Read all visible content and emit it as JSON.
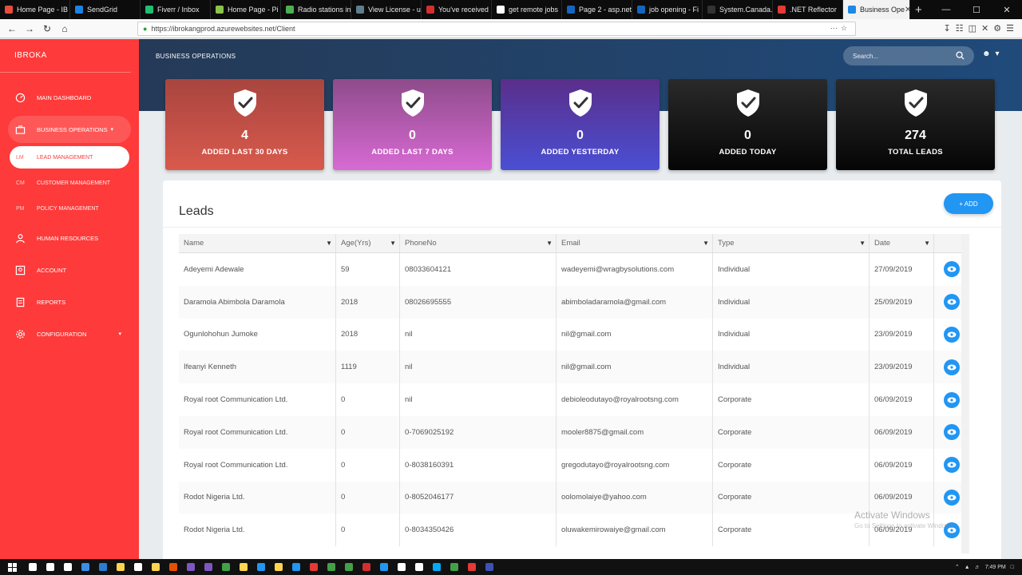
{
  "browser": {
    "tabs": [
      {
        "label": "Home Page - IB",
        "color": "#e84c3d"
      },
      {
        "label": "SendGrid",
        "color": "#1a82e2"
      },
      {
        "label": "Fiverr / Inbox",
        "color": "#1dbf73"
      },
      {
        "label": "Home Page - Pi",
        "color": "#8bc34a"
      },
      {
        "label": "Radio stations in",
        "color": "#4caf50"
      },
      {
        "label": "View License - u",
        "color": "#607d8b"
      },
      {
        "label": "You've received",
        "color": "#d32f2f"
      },
      {
        "label": "get remote jobs",
        "color": "#ffffff"
      },
      {
        "label": "Page 2 - asp.net",
        "color": "#1565c0"
      },
      {
        "label": "job opening - Fi",
        "color": "#1565c0"
      },
      {
        "label": "System.Canada.Te",
        "color": "#333333"
      },
      {
        "label": ".NET Reflector",
        "color": "#e53935"
      },
      {
        "label": "Business Ope",
        "color": "#1e88e5",
        "active": true
      }
    ],
    "url": "https://ibrokangprod.azurewebsites.net/Client"
  },
  "sidebar": {
    "brand": "IBROKA",
    "items": [
      {
        "label": "MAIN DASHBOARD",
        "icon": "dashboard-icon"
      },
      {
        "label": "BUSINESS OPERATIONS",
        "icon": "briefcase-icon",
        "open": true
      },
      {
        "label": "HUMAN RESOURCES",
        "icon": "person-icon"
      },
      {
        "label": "ACCOUNT",
        "icon": "account-icon"
      },
      {
        "label": "REPORTS",
        "icon": "reports-icon"
      },
      {
        "label": "CONFIGURATION",
        "icon": "gear-icon"
      }
    ],
    "subitems": [
      {
        "abbr": "LM",
        "label": "LEAD MANAGEMENT",
        "active": true
      },
      {
        "abbr": "CM",
        "label": "CUSTOMER MANAGEMENT"
      },
      {
        "abbr": "PM",
        "label": "POLICY MANAGEMENT"
      }
    ]
  },
  "header": {
    "title": "BUSINESS OPERATIONS",
    "search_placeholder": "Search..."
  },
  "cards": [
    {
      "value": "4",
      "label": "ADDED LAST 30 DAYS",
      "color_from": "#a8453f",
      "color_to": "#d95a4d"
    },
    {
      "value": "0",
      "label": "ADDED LAST 7 DAYS",
      "color_from": "#8e4b8a",
      "color_to": "#d86ad4"
    },
    {
      "value": "0",
      "label": "ADDED YESTERDAY",
      "color_from": "#5a2e8a",
      "color_to": "#4a4fd4"
    },
    {
      "value": "0",
      "label": "ADDED TODAY",
      "color_from": "#2a2a2a",
      "color_to": "#050505"
    },
    {
      "value": "274",
      "label": "TOTAL LEADS",
      "color_from": "#2a2a2a",
      "color_to": "#050505"
    }
  ],
  "leads": {
    "title": "Leads",
    "add_label": "+ ADD",
    "columns": [
      "Name",
      "Age(Yrs)",
      "PhoneNo",
      "Email",
      "Type",
      "Date"
    ],
    "rows": [
      [
        "Adeyemi Adewale",
        "59",
        "08033604121",
        "wadeyemi@wragbysolutions.com",
        "Individual",
        "27/09/2019"
      ],
      [
        "Daramola Abimbola Daramola",
        "2018",
        "08026695555",
        "abimboladaramola@gmail.com",
        "Individual",
        "25/09/2019"
      ],
      [
        "Ogunlohohun Jumoke",
        "2018",
        "nil",
        "nil@gmail.com",
        "Individual",
        "23/09/2019"
      ],
      [
        "Ifeanyi Kenneth",
        "1119",
        "nil",
        "nil@gmail.com",
        "Individual",
        "23/09/2019"
      ],
      [
        "Royal root Communication Ltd.",
        "0",
        "nil",
        "debioleodutayo@royalrootsng.com",
        "Corporate",
        "06/09/2019"
      ],
      [
        "Royal root Communication Ltd.",
        "0",
        "0-7069025192",
        "mooler8875@gmail.com",
        "Corporate",
        "06/09/2019"
      ],
      [
        "Royal root Communication Ltd.",
        "0",
        "0-8038160391",
        "gregodutayo@royalrootsng.com",
        "Corporate",
        "06/09/2019"
      ],
      [
        "Rodot Nigeria Ltd.",
        "0",
        "0-8052046177",
        "oolomolaiye@yahoo.com",
        "Corporate",
        "06/09/2019"
      ],
      [
        "Rodot Nigeria Ltd.",
        "0",
        "0-8034350426",
        "oluwakemirowaiye@gmail.com",
        "Corporate",
        "06/09/2019"
      ]
    ]
  },
  "watermark": {
    "line1": "Activate Windows",
    "line2": "Go to Settings to activate Windows."
  },
  "taskbar": {
    "clock": "7:49 PM",
    "icons": [
      "#ffffff",
      "#ffffff",
      "#ffffff",
      "#3a8ee6",
      "#2b7cd3",
      "#ffd54f",
      "#ffffff",
      "#ffd54f",
      "#e65100",
      "#7e57c2",
      "#7e57c2",
      "#43a047",
      "#ffd54f",
      "#2196f3",
      "#ffd54f",
      "#2196f3",
      "#e53935",
      "#43a047",
      "#43a047",
      "#d32f2f",
      "#2196f3",
      "#ffffff",
      "#ffffff",
      "#03a9f4",
      "#43a047",
      "#e53935",
      "#3f51b5"
    ]
  }
}
